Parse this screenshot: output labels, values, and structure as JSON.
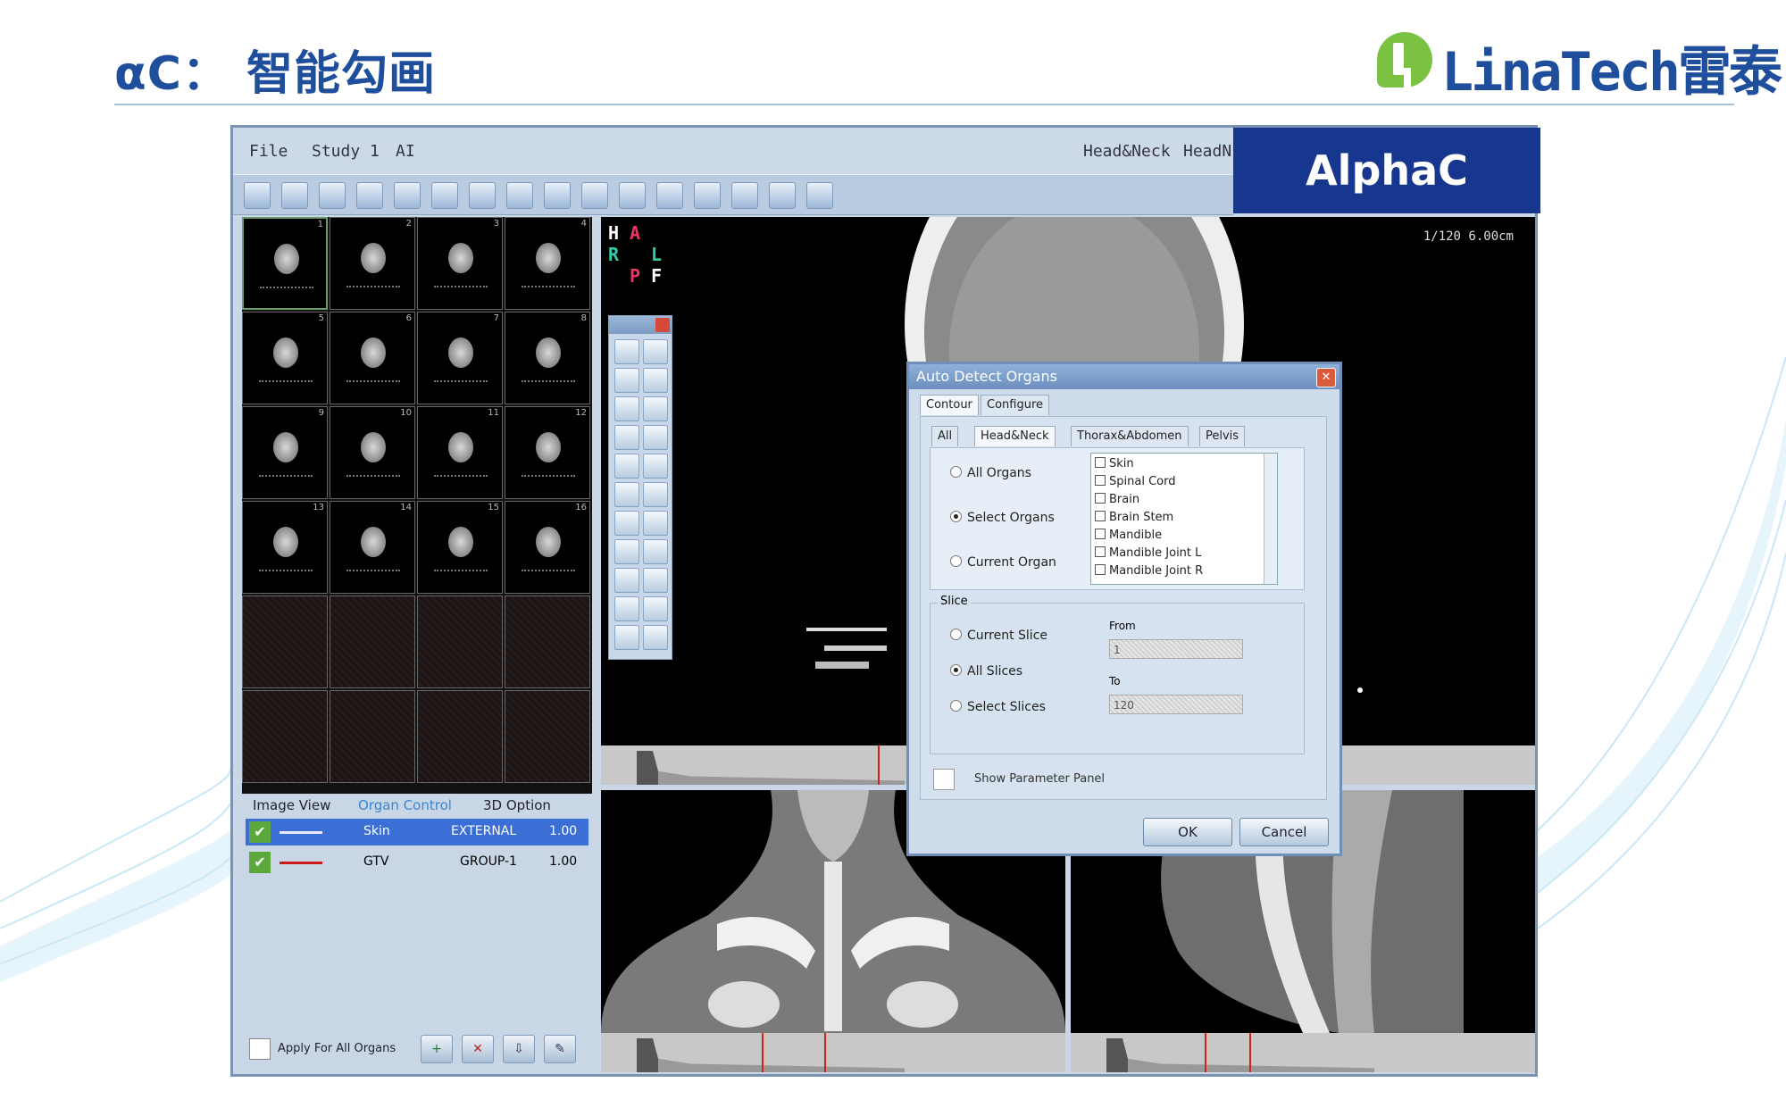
{
  "slide": {
    "title": "αC： 智能勾画",
    "logo_text": "LinaTech雷泰"
  },
  "app": {
    "menu": [
      "File",
      "Study 1",
      "AI"
    ],
    "menu_right": [
      "Head&Neck",
      "HeadN"
    ],
    "demo_banner": "AlphaC Demo"
  },
  "thumbnails": [
    "1",
    "2",
    "3",
    "4",
    "5",
    "6",
    "7",
    "8",
    "9",
    "10",
    "11",
    "12",
    "13",
    "14",
    "15",
    "16"
  ],
  "main_view": {
    "orientation": {
      "top": "H",
      "top2": "A",
      "left": "R",
      "right": "L",
      "bottom": "P",
      "bottom2": "F"
    },
    "slice_info": "1/120  6.00cm"
  },
  "organ_panel": {
    "tabs": [
      "Image View",
      "Organ Control",
      "3D Option"
    ],
    "rows": [
      {
        "name": "Skin",
        "type": "EXTERNAL",
        "value": "1.00",
        "selected": true,
        "color": "#e8e8ff"
      },
      {
        "name": "GTV",
        "type": "GROUP-1",
        "value": "1.00",
        "selected": false,
        "color": "#cc1a1a"
      }
    ],
    "apply_label": "Apply For All Organs"
  },
  "dialog": {
    "title": "Auto Detect Organs",
    "top_tabs": [
      "Contour",
      "Configure"
    ],
    "region_tabs": [
      "All",
      "Head&Neck",
      "Thorax&Abdomen",
      "Pelvis"
    ],
    "organ_options": [
      "All Organs",
      "Select Organs",
      "Current Organ"
    ],
    "organ_selected": 1,
    "organs": [
      "Skin",
      "Spinal Cord",
      "Brain",
      "Brain Stem",
      "Mandible",
      "Mandible Joint L",
      "Mandible Joint R"
    ],
    "slice_group_label": "Slice",
    "slice_options": [
      "Current Slice",
      "All Slices",
      "Select Slices"
    ],
    "slice_selected": 1,
    "from_label": "From",
    "from_value": "1",
    "to_label": "To",
    "to_value": "120",
    "param_label": "Show Parameter Panel",
    "ok_label": "OK",
    "cancel_label": "Cancel"
  }
}
